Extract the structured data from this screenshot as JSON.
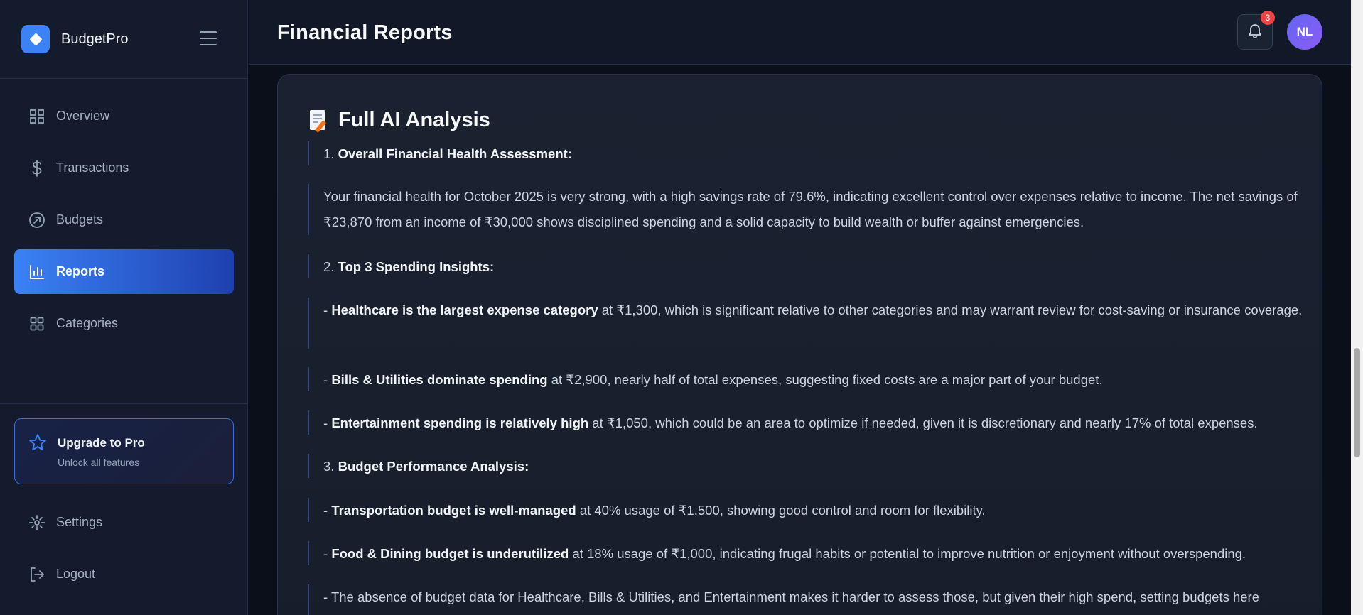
{
  "brand": {
    "name": "BudgetPro"
  },
  "nav": {
    "items": [
      {
        "label": "Overview",
        "icon": "grid-icon"
      },
      {
        "label": "Transactions",
        "icon": "dollar-icon"
      },
      {
        "label": "Budgets",
        "icon": "target-icon"
      },
      {
        "label": "Reports",
        "icon": "bar-chart-icon",
        "active": true
      },
      {
        "label": "Categories",
        "icon": "categories-icon"
      }
    ]
  },
  "upgrade": {
    "title": "Upgrade to Pro",
    "subtitle": "Unlock all features"
  },
  "footer_nav": {
    "settings": "Settings",
    "logout": "Logout"
  },
  "header": {
    "title": "Financial Reports",
    "notification_count": "3",
    "avatar_initials": "NL"
  },
  "analysis": {
    "title": "Full AI Analysis",
    "paragraphs": [
      {
        "prefix": "1. ",
        "bold": "Overall Financial Health Assessment:",
        "text": ""
      },
      {
        "prefix": "",
        "bold": "",
        "text": "Your financial health for October 2025 is very strong, with a high savings rate of 79.6%, indicating excellent control over expenses relative to income. The net savings of ₹23,870 from an income of ₹30,000 shows disciplined spending and a solid capacity to build wealth or buffer against emergencies."
      },
      {
        "prefix": "2. ",
        "bold": "Top 3 Spending Insights:",
        "text": ""
      },
      {
        "prefix": "- ",
        "bold": "Healthcare is the largest expense category",
        "text": " at ₹1,300, which is significant relative to other categories and may warrant review for cost-saving or insurance coverage."
      },
      {
        "prefix": "- ",
        "bold": "Bills & Utilities dominate spending",
        "text": " at ₹2,900, nearly half of total expenses, suggesting fixed costs are a major part of your budget."
      },
      {
        "prefix": "- ",
        "bold": "Entertainment spending is relatively high",
        "text": " at ₹1,050, which could be an area to optimize if needed, given it is discretionary and nearly 17% of total expenses."
      },
      {
        "prefix": "3. ",
        "bold": "Budget Performance Analysis:",
        "text": ""
      },
      {
        "prefix": "- ",
        "bold": "Transportation budget is well-managed",
        "text": " at 40% usage of ₹1,500, showing good control and room for flexibility."
      },
      {
        "prefix": "- ",
        "bold": "Food & Dining budget is underutilized",
        "text": " at 18% usage of ₹1,000, indicating frugal habits or potential to improve nutrition or enjoyment without overspending."
      },
      {
        "prefix": "- ",
        "bold": "",
        "text": "The absence of budget data for Healthcare, Bills & Utilities, and Entertainment makes it harder to assess those, but given their high spend, setting budgets here"
      }
    ]
  },
  "colors": {
    "accent": "#3b82f6",
    "badge": "#ef4444",
    "avatar": "#6366f1"
  }
}
